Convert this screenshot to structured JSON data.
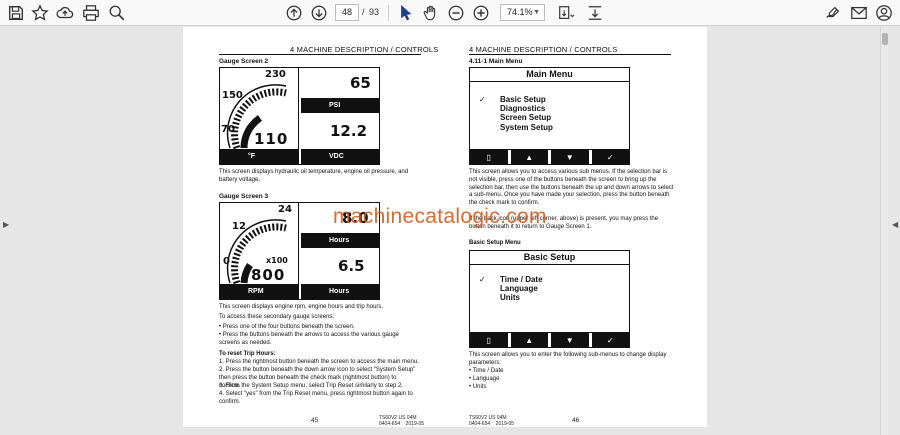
{
  "toolbar": {
    "page_current": "48",
    "page_separator": "/",
    "page_total": "93",
    "zoom": "74.1%",
    "icons": [
      "save-icon",
      "bookmark-star-icon",
      "upload-icon",
      "print-icon",
      "zoom-search-icon",
      "page-up-icon",
      "page-down-icon",
      "select-cursor-icon",
      "hand-pan-icon",
      "zoom-out-icon",
      "zoom-in-icon",
      "page-fit-icon",
      "scroll-mode-icon",
      "sign-icon",
      "email-icon",
      "account-icon"
    ]
  },
  "left_page": {
    "header": "4 MACHINE DESCRIPTION / CONTROLS",
    "section1_title": "Gauge Screen 2",
    "gauge2": {
      "dial_top": "230",
      "dial_mid": "150",
      "dial_low": "70",
      "dial_value": "110",
      "left_unit": "°F",
      "top_value": "65",
      "top_unit": "PSI",
      "bottom_value": "12.2",
      "bottom_unit": "VDC"
    },
    "section1_text": "This screen displays hydraulic oil temperature, engine oil pressure, and battery voltage.",
    "section2_title": "Gauge Screen 3",
    "gauge3": {
      "dial_top": "24",
      "dial_mid": "12",
      "dial_low": "0",
      "multiplier": "x100",
      "dial_value": "800",
      "left_unit": "RPM",
      "top_value": "8.0",
      "top_unit": "Hours",
      "bottom_value": "6.5",
      "bottom_unit": "Hours"
    },
    "section2_text": "This screen displays engine rpm, engine hours and trip hours.",
    "access_intro": "To access these secondary gauge screens:",
    "access_bullet1": "• Press one of the four buttons beneath the screen.",
    "access_bullet2": "• Press the buttons beneath the arrows to access the various gauge screens as needed.",
    "reset_title": "To reset Trip Hours:",
    "reset_step1": "1. Press the rightmost button beneath the screen to access the main menu.",
    "reset_step2": "2. Press the button beneath the down arrow icon to select \"System Setup\" then press the button beneath the check mark (rightmost button) to confirm.",
    "reset_step3": "3. From the System Setup menu, select Trip Reset similarly to step 2.",
    "reset_step4": "4. Select \"yes\" from the Trip Reset menu, press rightmost button again to confirm.",
    "page_number": "45",
    "footer_code": "TS60V2 US 04M\n0404-654    2019-05"
  },
  "right_page": {
    "header": "4 MACHINE DESCRIPTION / CONTROLS",
    "section1_title": "4.11-1 Main Menu",
    "main_menu": {
      "title": "Main Menu",
      "check": "✓",
      "items": [
        "Basic Setup",
        "Diagnostics",
        "Screen Setup",
        "System Setup"
      ]
    },
    "section1_text": "This screen allows you to access various sub menus. If the selection bar is not visible, press one of the buttons beneath the screen to bring up the selection bar, then use the buttons beneath the up and down arrows to select a sub-menu. Once you have made your selection, press the button beneath the check mark to confirm.",
    "section1_text2": "If the back icon (upper left corner, above) is present, you may press the button beneath it to return to Gauge Screen 1.",
    "section2_title": "Basic Setup Menu",
    "basic_menu": {
      "title": "Basic Setup",
      "check": "✓",
      "items": [
        "Time / Date",
        "Language",
        "Units"
      ]
    },
    "section2_text": "This screen allows you to enter the following sub-menus to change display parameters:",
    "basic_bullets": [
      "• Time / Date",
      "• Language",
      "• Units"
    ],
    "page_number": "46",
    "footer_code": "TS60V2 US 04M\n0404-654    2019-05"
  },
  "watermark": "machinecatalogic.com"
}
